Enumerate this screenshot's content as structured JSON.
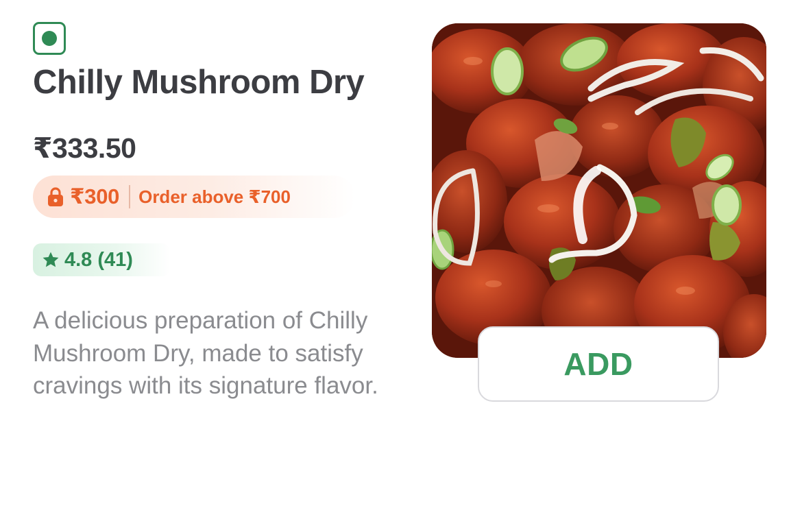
{
  "item": {
    "title": "Chilly Mushroom Dry",
    "price": "₹333.50",
    "veg_indicator": "veg-icon",
    "offer": {
      "price": "₹300",
      "condition": "Order above ₹700",
      "icon": "lock-icon"
    },
    "rating": {
      "text": "4.8 (41)",
      "icon": "star-icon"
    },
    "description": "A delicious preparation of Chilly Mushroom Dry, made to satisfy cravings with its signature flavor.",
    "add_label": "ADD"
  },
  "colors": {
    "veg_green": "#2f8a55",
    "offer_orange": "#e9602a",
    "title_text": "#3c3d42",
    "description_text": "#8a8b8f",
    "add_green": "#3a9a60"
  }
}
